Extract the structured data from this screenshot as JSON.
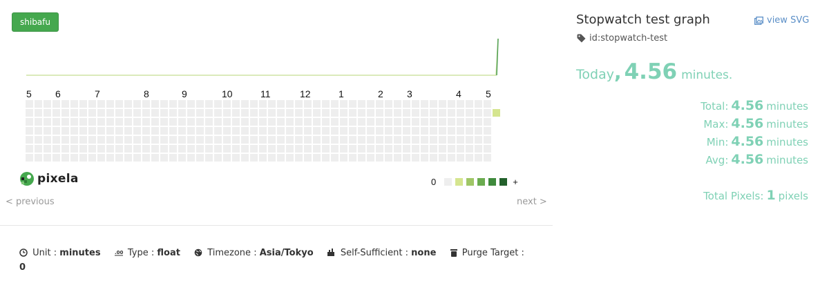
{
  "user": {
    "name": "shibafu"
  },
  "colors": {
    "brand": "#45a84e",
    "accent": "#7fd1b5",
    "link": "#5b8fc7",
    "empty_cell": "#eeeeee",
    "quantity_scale": [
      "#d5e58f",
      "#9fc666",
      "#6aab4f",
      "#3f8a3c",
      "#22602b"
    ]
  },
  "heatmap": {
    "month_labels": [
      "5",
      "6",
      "7",
      "8",
      "9",
      "10",
      "11",
      "12",
      "1",
      "2",
      "3",
      "4",
      "5"
    ],
    "filled_cell": {
      "weekday_row": 1,
      "week_index": 52,
      "level": 1
    }
  },
  "logo": {
    "text": "pixela",
    "icon": "pixela-logo-icon"
  },
  "legend": {
    "min_label": "0",
    "max_label": "+"
  },
  "nav": {
    "previous": "< previous",
    "next": "next >"
  },
  "meta": {
    "unit_label": "Unit",
    "unit_value": "minutes",
    "type_label": "Type",
    "type_value": "float",
    "timezone_label": "Timezone",
    "timezone_value": "Asia/Tokyo",
    "self_sufficient_label": "Self-Sufficient",
    "self_sufficient_value": "none",
    "purge_label": "Purge Target",
    "purge_value": "0",
    "separator": ":"
  },
  "graph": {
    "title": "Stopwatch test graph",
    "view_svg": "view SVG",
    "id_text": "id:stopwatch-test"
  },
  "today": {
    "label": "Today",
    "comma": ",",
    "value": "4.56",
    "unit": "minutes."
  },
  "stats": [
    {
      "label": "Total:",
      "value": "4.56",
      "unit": "minutes"
    },
    {
      "label": "Max:",
      "value": "4.56",
      "unit": "minutes"
    },
    {
      "label": "Min:",
      "value": "4.56",
      "unit": "minutes"
    },
    {
      "label": "Avg:",
      "value": "4.56",
      "unit": "minutes"
    }
  ],
  "total_pixels": {
    "label": "Total Pixels:",
    "value": "1",
    "unit": "pixels"
  }
}
